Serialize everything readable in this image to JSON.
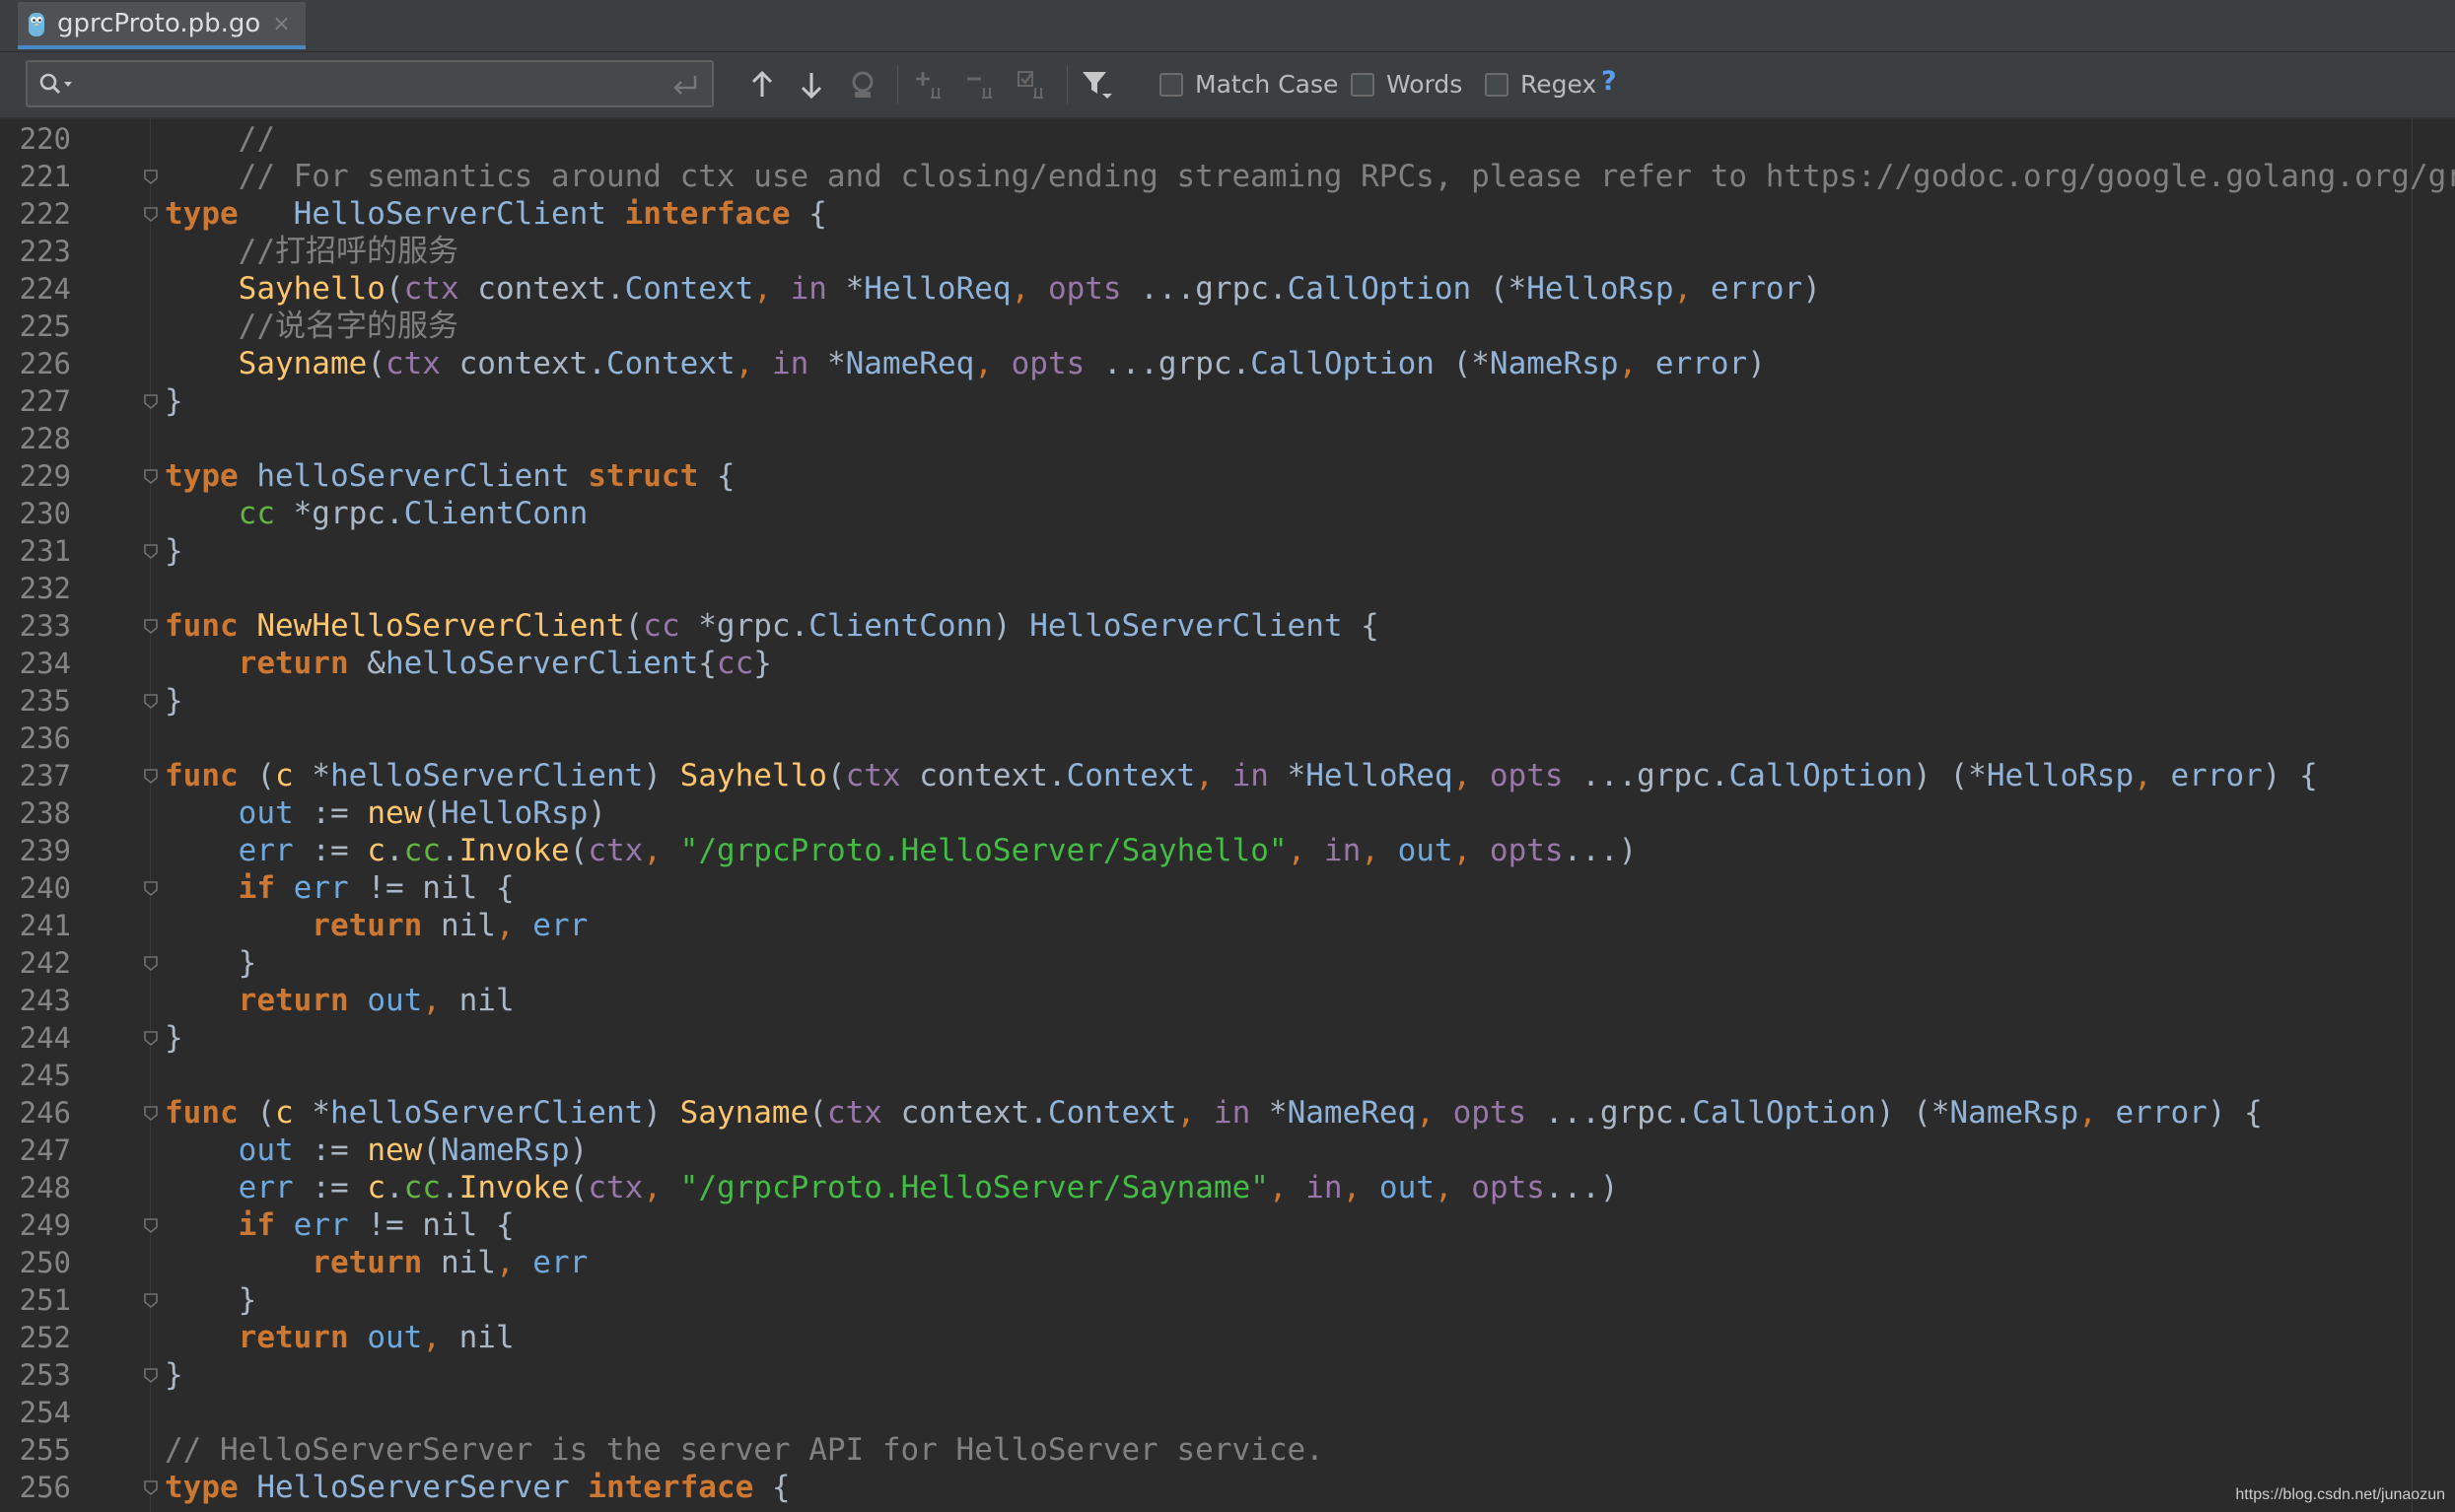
{
  "tab": {
    "title": "gprcProto.pb.go",
    "close": "×"
  },
  "findbar": {
    "search_value": "",
    "options": {
      "match_case": "Match Case",
      "words": "Words",
      "regex": "Regex",
      "help": "?"
    }
  },
  "icons": [
    "go-file-icon",
    "search-icon",
    "enter-icon",
    "arrow-up-icon",
    "arrow-down-icon",
    "find-occurrence-icon",
    "add-selection-icon",
    "remove-selection-icon",
    "select-all-icon",
    "filter-icon"
  ],
  "colors": {
    "background": "#2b2b2b",
    "keyword": "#cc7832",
    "function": "#ffc66d",
    "type": "#8fb3d9",
    "param": "#9876aa",
    "string": "#44bb44",
    "comment": "#808080",
    "field": "#62b543"
  },
  "lines": [
    {
      "n": "220",
      "fold": false,
      "t": [
        [
          "cm",
          "    //"
        ]
      ]
    },
    {
      "n": "221",
      "fold": true,
      "t": [
        [
          "cm",
          "    // For semantics around ctx use and closing/ending streaming RPCs, please refer to https://godoc.org/google.golang.org/grpc"
        ]
      ]
    },
    {
      "n": "222",
      "fold": true,
      "t": [
        [
          "kw",
          "type"
        ],
        [
          "",
          "   "
        ],
        [
          "ty",
          "HelloServerClient"
        ],
        [
          "",
          " "
        ],
        [
          "kw",
          "interface"
        ],
        [
          "",
          " {"
        ]
      ]
    },
    {
      "n": "223",
      "fold": false,
      "t": [
        [
          "cm",
          "    //打招呼的服务"
        ]
      ]
    },
    {
      "n": "224",
      "fold": false,
      "t": [
        [
          "fn",
          "    Sayhello"
        ],
        [
          "",
          "("
        ],
        [
          "pm",
          "ctx"
        ],
        [
          "",
          " context."
        ],
        [
          "ty",
          "Context"
        ],
        [
          "pn",
          ","
        ],
        [
          "",
          " "
        ],
        [
          "pm",
          "in"
        ],
        [
          "",
          " *"
        ],
        [
          "ty",
          "HelloReq"
        ],
        [
          "pn",
          ","
        ],
        [
          "",
          " "
        ],
        [
          "pm",
          "opts"
        ],
        [
          "",
          " ...grpc."
        ],
        [
          "ty",
          "CallOption"
        ],
        [
          "",
          " (*"
        ],
        [
          "ty",
          "HelloRsp"
        ],
        [
          "pn",
          ","
        ],
        [
          "",
          " "
        ],
        [
          "ty",
          "error"
        ],
        [
          "",
          ")"
        ]
      ]
    },
    {
      "n": "225",
      "fold": false,
      "t": [
        [
          "cm",
          "    //说名字的服务"
        ]
      ]
    },
    {
      "n": "226",
      "fold": false,
      "t": [
        [
          "fn",
          "    Sayname"
        ],
        [
          "",
          "("
        ],
        [
          "pm",
          "ctx"
        ],
        [
          "",
          " context."
        ],
        [
          "ty",
          "Context"
        ],
        [
          "pn",
          ","
        ],
        [
          "",
          " "
        ],
        [
          "pm",
          "in"
        ],
        [
          "",
          " *"
        ],
        [
          "ty",
          "NameReq"
        ],
        [
          "pn",
          ","
        ],
        [
          "",
          " "
        ],
        [
          "pm",
          "opts"
        ],
        [
          "",
          " ...grpc."
        ],
        [
          "ty",
          "CallOption"
        ],
        [
          "",
          " (*"
        ],
        [
          "ty",
          "NameRsp"
        ],
        [
          "pn",
          ","
        ],
        [
          "",
          " "
        ],
        [
          "ty",
          "error"
        ],
        [
          "",
          ")"
        ]
      ]
    },
    {
      "n": "227",
      "fold": true,
      "t": [
        [
          "",
          "}"
        ]
      ]
    },
    {
      "n": "228",
      "fold": false,
      "t": []
    },
    {
      "n": "229",
      "fold": true,
      "t": [
        [
          "kw",
          "type"
        ],
        [
          "",
          " "
        ],
        [
          "ty",
          "helloServerClient"
        ],
        [
          "",
          " "
        ],
        [
          "kw",
          "struct"
        ],
        [
          "",
          " {"
        ]
      ]
    },
    {
      "n": "230",
      "fold": false,
      "t": [
        [
          "fl",
          "    cc"
        ],
        [
          "",
          " *grpc."
        ],
        [
          "ty",
          "ClientConn"
        ]
      ]
    },
    {
      "n": "231",
      "fold": true,
      "t": [
        [
          "",
          "}"
        ]
      ]
    },
    {
      "n": "232",
      "fold": false,
      "t": []
    },
    {
      "n": "233",
      "fold": true,
      "t": [
        [
          "kw",
          "func"
        ],
        [
          "",
          " "
        ],
        [
          "fn",
          "NewHelloServerClient"
        ],
        [
          "",
          "("
        ],
        [
          "pm",
          "cc"
        ],
        [
          "",
          " *grpc."
        ],
        [
          "ty",
          "ClientConn"
        ],
        [
          "",
          ") "
        ],
        [
          "ty",
          "HelloServerClient"
        ],
        [
          "",
          " {"
        ]
      ]
    },
    {
      "n": "234",
      "fold": false,
      "t": [
        [
          "kw",
          "    return"
        ],
        [
          "",
          " &"
        ],
        [
          "ty",
          "helloServerClient"
        ],
        [
          "",
          "{"
        ],
        [
          "pm",
          "cc"
        ],
        [
          "",
          "}"
        ]
      ]
    },
    {
      "n": "235",
      "fold": true,
      "t": [
        [
          "",
          "}"
        ]
      ]
    },
    {
      "n": "236",
      "fold": false,
      "t": []
    },
    {
      "n": "237",
      "fold": true,
      "t": [
        [
          "kw",
          "func"
        ],
        [
          "",
          " ("
        ],
        [
          "fn",
          "c"
        ],
        [
          "",
          " *"
        ],
        [
          "ty",
          "helloServerClient"
        ],
        [
          "",
          ") "
        ],
        [
          "fn",
          "Sayhello"
        ],
        [
          "",
          "("
        ],
        [
          "pm",
          "ctx"
        ],
        [
          "",
          " context."
        ],
        [
          "ty",
          "Context"
        ],
        [
          "pn",
          ","
        ],
        [
          "",
          " "
        ],
        [
          "pm",
          "in"
        ],
        [
          "",
          " *"
        ],
        [
          "ty",
          "HelloReq"
        ],
        [
          "pn",
          ","
        ],
        [
          "",
          " "
        ],
        [
          "pm",
          "opts"
        ],
        [
          "",
          " ...grpc."
        ],
        [
          "ty",
          "CallOption"
        ],
        [
          "",
          ") (*"
        ],
        [
          "ty",
          "HelloRsp"
        ],
        [
          "pn",
          ","
        ],
        [
          "",
          " "
        ],
        [
          "ty",
          "error"
        ],
        [
          "",
          ") {"
        ]
      ]
    },
    {
      "n": "238",
      "fold": false,
      "t": [
        [
          "lv",
          "    out"
        ],
        [
          "",
          " := "
        ],
        [
          "fn",
          "new"
        ],
        [
          "",
          "("
        ],
        [
          "ty",
          "HelloRsp"
        ],
        [
          "",
          ")"
        ]
      ]
    },
    {
      "n": "239",
      "fold": false,
      "t": [
        [
          "lv",
          "    err"
        ],
        [
          "",
          " := "
        ],
        [
          "fn",
          "c"
        ],
        [
          "",
          "."
        ],
        [
          "fl",
          "cc"
        ],
        [
          "",
          "."
        ],
        [
          "fn",
          "Invoke"
        ],
        [
          "",
          "("
        ],
        [
          "pm",
          "ctx"
        ],
        [
          "pn",
          ","
        ],
        [
          "",
          " "
        ],
        [
          "st",
          "\"/grpcProto.HelloServer/Sayhello\""
        ],
        [
          "pn",
          ","
        ],
        [
          "",
          " "
        ],
        [
          "pm",
          "in"
        ],
        [
          "pn",
          ","
        ],
        [
          "",
          " "
        ],
        [
          "lv",
          "out"
        ],
        [
          "pn",
          ","
        ],
        [
          "",
          " "
        ],
        [
          "pm",
          "opts"
        ],
        [
          "",
          "...)"
        ]
      ]
    },
    {
      "n": "240",
      "fold": true,
      "t": [
        [
          "kw",
          "    if"
        ],
        [
          "",
          " "
        ],
        [
          "lv",
          "err"
        ],
        [
          "",
          " != nil {"
        ]
      ]
    },
    {
      "n": "241",
      "fold": false,
      "t": [
        [
          "kw",
          "        return"
        ],
        [
          "",
          " nil"
        ],
        [
          "pn",
          ","
        ],
        [
          "",
          " "
        ],
        [
          "lv",
          "err"
        ]
      ]
    },
    {
      "n": "242",
      "fold": true,
      "t": [
        [
          "",
          "    }"
        ]
      ]
    },
    {
      "n": "243",
      "fold": false,
      "t": [
        [
          "kw",
          "    return"
        ],
        [
          "",
          " "
        ],
        [
          "lv",
          "out"
        ],
        [
          "pn",
          ","
        ],
        [
          "",
          " nil"
        ]
      ]
    },
    {
      "n": "244",
      "fold": true,
      "t": [
        [
          "",
          "}"
        ]
      ]
    },
    {
      "n": "245",
      "fold": false,
      "t": []
    },
    {
      "n": "246",
      "fold": true,
      "t": [
        [
          "kw",
          "func"
        ],
        [
          "",
          " ("
        ],
        [
          "fn",
          "c"
        ],
        [
          "",
          " *"
        ],
        [
          "ty",
          "helloServerClient"
        ],
        [
          "",
          ") "
        ],
        [
          "fn",
          "Sayname"
        ],
        [
          "",
          "("
        ],
        [
          "pm",
          "ctx"
        ],
        [
          "",
          " context."
        ],
        [
          "ty",
          "Context"
        ],
        [
          "pn",
          ","
        ],
        [
          "",
          " "
        ],
        [
          "pm",
          "in"
        ],
        [
          "",
          " *"
        ],
        [
          "ty",
          "NameReq"
        ],
        [
          "pn",
          ","
        ],
        [
          "",
          " "
        ],
        [
          "pm",
          "opts"
        ],
        [
          "",
          " ...grpc."
        ],
        [
          "ty",
          "CallOption"
        ],
        [
          "",
          ") (*"
        ],
        [
          "ty",
          "NameRsp"
        ],
        [
          "pn",
          ","
        ],
        [
          "",
          " "
        ],
        [
          "ty",
          "error"
        ],
        [
          "",
          ") {"
        ]
      ]
    },
    {
      "n": "247",
      "fold": false,
      "t": [
        [
          "lv",
          "    out"
        ],
        [
          "",
          " := "
        ],
        [
          "fn",
          "new"
        ],
        [
          "",
          "("
        ],
        [
          "ty",
          "NameRsp"
        ],
        [
          "",
          ")"
        ]
      ]
    },
    {
      "n": "248",
      "fold": false,
      "t": [
        [
          "lv",
          "    err"
        ],
        [
          "",
          " := "
        ],
        [
          "fn",
          "c"
        ],
        [
          "",
          "."
        ],
        [
          "fl",
          "cc"
        ],
        [
          "",
          "."
        ],
        [
          "fn",
          "Invoke"
        ],
        [
          "",
          "("
        ],
        [
          "pm",
          "ctx"
        ],
        [
          "pn",
          ","
        ],
        [
          "",
          " "
        ],
        [
          "st",
          "\"/grpcProto.HelloServer/Sayname\""
        ],
        [
          "pn",
          ","
        ],
        [
          "",
          " "
        ],
        [
          "pm",
          "in"
        ],
        [
          "pn",
          ","
        ],
        [
          "",
          " "
        ],
        [
          "lv",
          "out"
        ],
        [
          "pn",
          ","
        ],
        [
          "",
          " "
        ],
        [
          "pm",
          "opts"
        ],
        [
          "",
          "...)"
        ]
      ]
    },
    {
      "n": "249",
      "fold": true,
      "t": [
        [
          "kw",
          "    if"
        ],
        [
          "",
          " "
        ],
        [
          "lv",
          "err"
        ],
        [
          "",
          " != nil {"
        ]
      ]
    },
    {
      "n": "250",
      "fold": false,
      "t": [
        [
          "kw",
          "        return"
        ],
        [
          "",
          " nil"
        ],
        [
          "pn",
          ","
        ],
        [
          "",
          " "
        ],
        [
          "lv",
          "err"
        ]
      ]
    },
    {
      "n": "251",
      "fold": true,
      "t": [
        [
          "",
          "    }"
        ]
      ]
    },
    {
      "n": "252",
      "fold": false,
      "t": [
        [
          "kw",
          "    return"
        ],
        [
          "",
          " "
        ],
        [
          "lv",
          "out"
        ],
        [
          "pn",
          ","
        ],
        [
          "",
          " nil"
        ]
      ]
    },
    {
      "n": "253",
      "fold": true,
      "t": [
        [
          "",
          "}"
        ]
      ]
    },
    {
      "n": "254",
      "fold": false,
      "t": []
    },
    {
      "n": "255",
      "fold": false,
      "t": [
        [
          "cm",
          "// HelloServerServer is the server API for HelloServer service."
        ]
      ]
    },
    {
      "n": "256",
      "fold": true,
      "t": [
        [
          "kw",
          "type"
        ],
        [
          "",
          " "
        ],
        [
          "ty",
          "HelloServerServer"
        ],
        [
          "",
          " "
        ],
        [
          "kw",
          "interface"
        ],
        [
          "",
          " {"
        ]
      ]
    }
  ],
  "watermark": "https://blog.csdn.net/junaozun"
}
